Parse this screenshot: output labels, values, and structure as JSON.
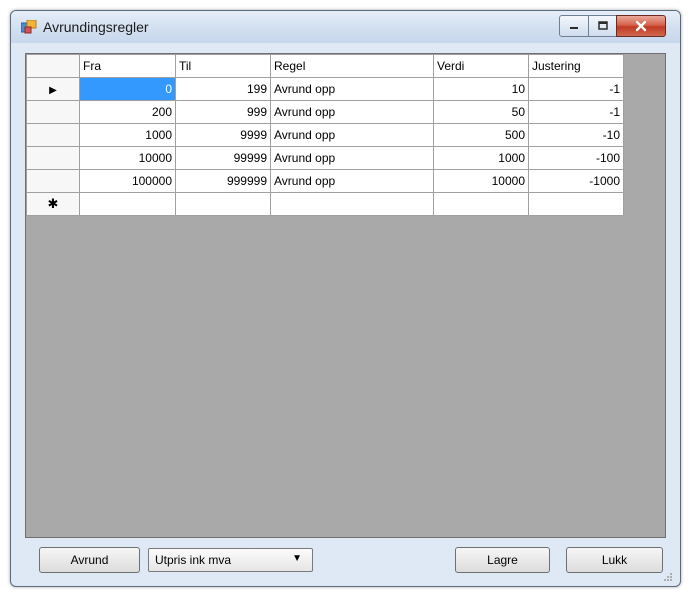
{
  "window": {
    "title": "Avrundingsregler",
    "controls": [
      "minimize-icon",
      "maximize-icon",
      "close-icon"
    ]
  },
  "grid": {
    "columns": [
      "Fra",
      "Til",
      "Regel",
      "Verdi",
      "Justering"
    ],
    "rows": [
      {
        "fra": "0",
        "til": "199",
        "regel": "Avrund opp",
        "verdi": "10",
        "justering": "-1",
        "current": true
      },
      {
        "fra": "200",
        "til": "999",
        "regel": "Avrund opp",
        "verdi": "50",
        "justering": "-1"
      },
      {
        "fra": "1000",
        "til": "9999",
        "regel": "Avrund opp",
        "verdi": "500",
        "justering": "-10"
      },
      {
        "fra": "10000",
        "til": "99999",
        "regel": "Avrund opp",
        "verdi": "1000",
        "justering": "-100"
      },
      {
        "fra": "100000",
        "til": "999999",
        "regel": "Avrund opp",
        "verdi": "10000",
        "justering": "-1000"
      }
    ],
    "current_row_marker": "▶",
    "new_row_marker": "✱"
  },
  "footer": {
    "round_button": "Avrund",
    "price_select": {
      "value": "Utpris ink mva"
    },
    "save_button": "Lagre",
    "close_button": "Lukk"
  }
}
